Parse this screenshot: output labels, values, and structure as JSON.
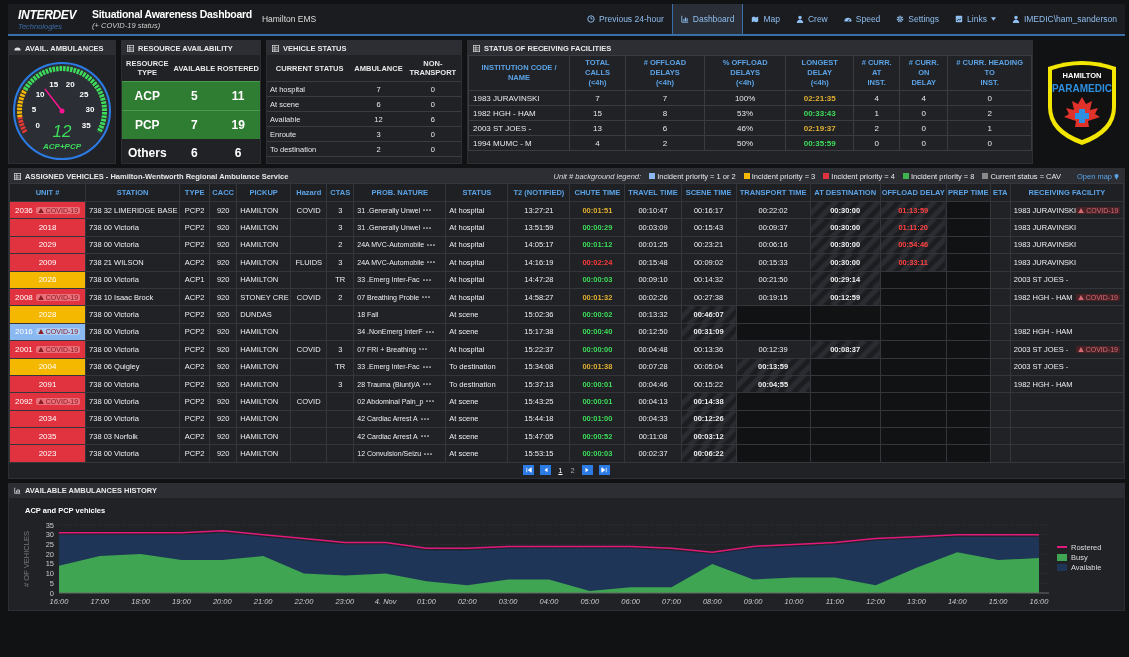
{
  "header": {
    "brand": "INTERDEV",
    "brand_sub": "Technologies",
    "title": "Situational Awareness Dashboard",
    "subtitle": "(+ COVID-19 status)",
    "org": "Hamilton EMS",
    "nav": [
      {
        "label": "Previous 24-hour",
        "kind": "clock",
        "selected": false
      },
      {
        "label": "Dashboard",
        "kind": "chart",
        "selected": true
      },
      {
        "label": "Map",
        "kind": "map",
        "selected": false
      },
      {
        "label": "Crew",
        "kind": "user",
        "selected": false
      },
      {
        "label": "Speed",
        "kind": "gauge",
        "selected": false
      },
      {
        "label": "Settings",
        "kind": "gear",
        "selected": false
      },
      {
        "label": "Links",
        "kind": "link",
        "selected": false,
        "dropdown": true
      },
      {
        "label": "IMEDIC\\ham_sanderson",
        "kind": "user",
        "selected": false
      }
    ]
  },
  "avail_ambulances": {
    "title": "AVAIL. AMBULANCES",
    "value": "12",
    "label": "ACP+PCP",
    "level": 0.343,
    "ticks": [
      "0",
      "5",
      "10",
      "15",
      "20",
      "25",
      "30",
      "35"
    ]
  },
  "resource_availability": {
    "title": "RESOURCE AVAILABILITY",
    "columns": [
      "RESOURCE TYPE",
      "AVAILABLE",
      "ROSTERED"
    ],
    "rows": [
      {
        "type": "ACP",
        "available": "5",
        "rostered": "11",
        "highlighted": true
      },
      {
        "type": "PCP",
        "available": "7",
        "rostered": "19",
        "highlighted": true
      },
      {
        "type": "Others",
        "available": "6",
        "rostered": "6",
        "highlighted": false
      }
    ]
  },
  "vehicle_status": {
    "title": "VEHICLE STATUS",
    "columns": [
      "CURRENT STATUS",
      "AMBULANCE",
      "NON-TRANSPORT"
    ],
    "rows": [
      [
        "At hospital",
        "7",
        "0"
      ],
      [
        "At scene",
        "6",
        "0"
      ],
      [
        "Available",
        "12",
        "6"
      ],
      [
        "Enroute",
        "3",
        "0"
      ],
      [
        "To destination",
        "2",
        "0"
      ]
    ]
  },
  "receiving_facilities": {
    "title": "STATUS OF RECEIVING FACILITIES",
    "columns": [
      {
        "label": "INSTITUTION CODE / NAME"
      },
      {
        "label": "TOTAL CALLS",
        "sub": "(<4h)"
      },
      {
        "label": "# OFFLOAD DELAYS",
        "sub": "(<4h)"
      },
      {
        "label": "% OFFLOAD DELAYS",
        "sub": "(<4h)"
      },
      {
        "label": "LONGEST DELAY",
        "sub": "(<4h)"
      },
      {
        "label": "# CURR. AT",
        "sub": "INST."
      },
      {
        "label": "# CURR. ON",
        "sub": "DELAY"
      },
      {
        "label": "# CURR. HEADING TO",
        "sub": "INST."
      }
    ],
    "rows": [
      {
        "name": "1983 JURAVINSKI",
        "total": "7",
        "delays": "7",
        "pct": "100%",
        "longest": {
          "text": "02:21:35",
          "color": "#e0b030"
        },
        "at": "4",
        "on_delay": "4",
        "heading": "0"
      },
      {
        "name": "1982 HGH - HAM",
        "total": "15",
        "delays": "8",
        "pct": "53%",
        "longest": {
          "text": "00:33:43",
          "color": "#3ddc5a"
        },
        "at": "1",
        "on_delay": "0",
        "heading": "2"
      },
      {
        "name": "2003 ST JOES -",
        "total": "13",
        "delays": "6",
        "pct": "46%",
        "longest": {
          "text": "02:19:37",
          "color": "#e0b030"
        },
        "at": "2",
        "on_delay": "0",
        "heading": "1"
      },
      {
        "name": "1994 MUMC - M",
        "total": "4",
        "delays": "2",
        "pct": "50%",
        "longest": {
          "text": "00:35:59",
          "color": "#3ddc5a"
        },
        "at": "0",
        "on_delay": "0",
        "heading": "0"
      }
    ]
  },
  "badge_logo": {
    "top": "HAMILTON",
    "main": "PARAMEDIC"
  },
  "assigned_vehicles": {
    "title": "ASSIGNED VEHICLES - Hamilton-Wentworth Regional Ambulance Service",
    "legend_label": "Unit # background legend:",
    "legend": [
      {
        "label": "Incident priority = 1 or 2",
        "color": "#8ab8f0"
      },
      {
        "label": "Incident priority = 3",
        "color": "#f5b800"
      },
      {
        "label": "Incident priority = 4",
        "color": "#e0323f"
      },
      {
        "label": "Incident priority = 8",
        "color": "#3fb34f"
      },
      {
        "label": "Current status = CAV",
        "color": "#8a8a8a"
      }
    ],
    "open_map": "Open map",
    "columns": [
      "UNIT #",
      "STATION",
      "TYPE",
      "CACC",
      "PICKUP",
      "Hazard",
      "CTAS",
      "PROB. NATURE",
      "STATUS",
      "T2 (NOTIFIED)",
      "CHUTE TIME",
      "TRAVEL TIME",
      "SCENE TIME",
      "TRANSPORT TIME",
      "AT DESTINATION",
      "OFFLOAD DELAY",
      "PREP TIME",
      "ETA",
      "RECEIVING FACILITY"
    ],
    "rows": [
      {
        "unit": "2036",
        "color": "#e0323f",
        "badge": "COVID-19",
        "station": "738 32 LIMERIDGE BASE",
        "type": "PCP2",
        "cacc": "920",
        "pickup": "HAMILTON",
        "hazard": "COVID",
        "ctas": "3",
        "nature": "31 .Generally Unwel",
        "more": true,
        "status": "At hospital",
        "t2": "13:27:21",
        "chute": {
          "text": "00:01:51",
          "color": "#e0b030"
        },
        "travel": "00:10:47",
        "scene": {
          "text": "00:16:17",
          "running": false
        },
        "transport": {
          "text": "00:22:02",
          "running": false
        },
        "at_destination": {
          "text": "00:30:00",
          "running": true
        },
        "offload": {
          "text": "01:13:59",
          "running": true
        },
        "facility": "1983 JURAVINSKI",
        "facility_badge": "COVID-19"
      },
      {
        "unit": "2018",
        "color": "#e0323f",
        "station": "738 00 Victoria",
        "type": "PCP2",
        "cacc": "920",
        "pickup": "HAMILTON",
        "ctas": "3",
        "nature": "31 .Generally Unwel",
        "more": true,
        "status": "At hospital",
        "t2": "13:51:59",
        "chute": {
          "text": "00:00:29",
          "color": "#3ddc5a"
        },
        "travel": "00:03:09",
        "scene": {
          "text": "00:15:43",
          "running": false
        },
        "transport": {
          "text": "00:09:37",
          "running": false
        },
        "at_destination": {
          "text": "00:30:00",
          "running": true
        },
        "offload": {
          "text": "01:11:20",
          "running": true
        },
        "facility": "1983 JURAVINSKI"
      },
      {
        "unit": "2029",
        "color": "#e0323f",
        "station": "738 00 Victoria",
        "type": "PCP2",
        "cacc": "920",
        "pickup": "HAMILTON",
        "ctas": "2",
        "nature": "24A MVC-Automobile",
        "more": true,
        "status": "At hospital",
        "t2": "14:05:17",
        "chute": {
          "text": "00:01:12",
          "color": "#3ddc5a"
        },
        "travel": "00:01:25",
        "scene": {
          "text": "00:23:21",
          "running": false
        },
        "transport": {
          "text": "00:06:16",
          "running": false
        },
        "at_destination": {
          "text": "00:30:00",
          "running": true
        },
        "offload": {
          "text": "00:54:46",
          "running": true
        },
        "facility": "1983 JURAVINSKI"
      },
      {
        "unit": "2009",
        "color": "#e0323f",
        "station": "738 21 WILSON",
        "type": "ACP2",
        "cacc": "920",
        "pickup": "HAMILTON",
        "hazard": "FLUIDS",
        "ctas": "3",
        "nature": "24A MVC-Automobile",
        "more": true,
        "status": "At hospital",
        "t2": "14:16:19",
        "chute": {
          "text": "00:02:24",
          "color": "#ff3b3b"
        },
        "travel": "00:15:48",
        "scene": {
          "text": "00:09:02",
          "running": false
        },
        "transport": {
          "text": "00:15:33",
          "running": false
        },
        "at_destination": {
          "text": "00:30:00",
          "running": true
        },
        "offload": {
          "text": "00:33:11",
          "running": true
        },
        "facility": "1983 JURAVINSKI"
      },
      {
        "unit": "2026",
        "color": "#f5b800",
        "station": "738 00 Victoria",
        "type": "ACP1",
        "cacc": "920",
        "pickup": "HAMILTON",
        "ctas": "TR",
        "nature": "33 .Emerg Inter-Fac",
        "more": true,
        "status": "At hospital",
        "t2": "14:47:28",
        "chute": {
          "text": "00:00:03",
          "color": "#3ddc5a"
        },
        "travel": "00:09:10",
        "scene": {
          "text": "00:14:32",
          "running": false
        },
        "transport": {
          "text": "00:21:50",
          "running": false
        },
        "at_destination": {
          "text": "00:29:14",
          "running": true
        },
        "facility": "2003 ST JOES -"
      },
      {
        "unit": "2008",
        "color": "#e0323f",
        "badge": "COVID-19",
        "station": "738 10 Isaac Brock",
        "type": "ACP2",
        "cacc": "920",
        "pickup": "STONEY CRE",
        "hazard": "COVID",
        "ctas": "2",
        "nature": "07 Breathing Proble",
        "more": true,
        "status": "At hospital",
        "t2": "14:58:27",
        "chute": {
          "text": "00:01:32",
          "color": "#e0b030"
        },
        "travel": "00:02:26",
        "scene": {
          "text": "00:27:38",
          "running": false
        },
        "transport": {
          "text": "00:19:15",
          "running": false
        },
        "at_destination": {
          "text": "00:12:59",
          "running": true
        },
        "facility": "1982 HGH - HAM",
        "facility_badge": "COVID-19"
      },
      {
        "unit": "2028",
        "color": "#f5b800",
        "station": "738 00 Victoria",
        "type": "PCP2",
        "cacc": "920",
        "pickup": "DUNDAS",
        "nature": "18 Fall",
        "more": false,
        "status": "At scene",
        "t2": "15:02:36",
        "chute": {
          "text": "00:00:02",
          "color": "#3ddc5a"
        },
        "travel": "00:13:32",
        "scene": {
          "text": "00:46:07",
          "running": true
        }
      },
      {
        "unit": "2016",
        "color": "#8ab8f0",
        "badge": "COVID-19",
        "station": "738 00 Victoria",
        "type": "PCP2",
        "cacc": "920",
        "pickup": "HAMILTON",
        "nature": "34 .NonEmerg InterF",
        "more": true,
        "status": "At scene",
        "t2": "15:17:38",
        "chute": {
          "text": "00:00:40",
          "color": "#3ddc5a"
        },
        "travel": "00:12:50",
        "scene": {
          "text": "00:31:09",
          "running": true
        },
        "facility": "1982 HGH - HAM"
      },
      {
        "unit": "2001",
        "color": "#e0323f",
        "badge": "COVID-19",
        "station": "738 00 Victoria",
        "type": "PCP2",
        "cacc": "920",
        "pickup": "HAMILTON",
        "hazard": "COVID",
        "ctas": "3",
        "nature": "07 FRI + Breathing",
        "more": true,
        "status": "At hospital",
        "t2": "15:22:37",
        "chute": {
          "text": "00:00:00",
          "color": "#3ddc5a"
        },
        "travel": "00:04:48",
        "scene": {
          "text": "00:13:36",
          "running": false
        },
        "transport": {
          "text": "00:12:39",
          "running": false
        },
        "at_destination": {
          "text": "00:08:37",
          "running": true
        },
        "facility": "2003 ST JOES -",
        "facility_badge": "COVID-19"
      },
      {
        "unit": "2004",
        "color": "#f5b800",
        "station": "738 06 Quigley",
        "type": "ACP2",
        "cacc": "920",
        "pickup": "HAMILTON",
        "ctas": "TR",
        "nature": "33 .Emerg Inter-Fac",
        "more": true,
        "status": "To destination",
        "t2": "15:34:08",
        "chute": {
          "text": "00:01:38",
          "color": "#e0b030"
        },
        "travel": "00:07:28",
        "scene": {
          "text": "00:05:04",
          "running": false
        },
        "transport": {
          "text": "00:13:59",
          "running": true
        },
        "facility": "2003 ST JOES -"
      },
      {
        "unit": "2091",
        "color": "#e0323f",
        "station": "738 00 Victoria",
        "type": "PCP2",
        "cacc": "920",
        "pickup": "HAMILTON",
        "ctas": "3",
        "nature": "28 Trauma (Blunt)/A",
        "more": true,
        "status": "To destination",
        "t2": "15:37:13",
        "chute": {
          "text": "00:00:01",
          "color": "#3ddc5a"
        },
        "travel": "00:04:46",
        "scene": {
          "text": "00:15:22",
          "running": false
        },
        "transport": {
          "text": "00:04:55",
          "running": true
        },
        "facility": "1982 HGH - HAM"
      },
      {
        "unit": "2092",
        "color": "#e0323f",
        "badge": "COVID-19",
        "station": "738 00 Victoria",
        "type": "PCP2",
        "cacc": "920",
        "pickup": "HAMILTON",
        "hazard": "COVID",
        "nature": "02 Abdominal Pain_p",
        "more": true,
        "status": "At scene",
        "t2": "15:43:25",
        "chute": {
          "text": "00:00:01",
          "color": "#3ddc5a"
        },
        "travel": "00:04:13",
        "scene": {
          "text": "00:14:38",
          "running": true
        }
      },
      {
        "unit": "2034",
        "color": "#e0323f",
        "station": "738 00 Victoria",
        "type": "PCP2",
        "cacc": "920",
        "pickup": "HAMILTON",
        "nature": "42 Cardiac Arrest A",
        "more": true,
        "status": "At scene",
        "t2": "15:44:18",
        "chute": {
          "text": "00:01:00",
          "color": "#3ddc5a"
        },
        "travel": "00:04:33",
        "scene": {
          "text": "00:12:26",
          "running": true
        }
      },
      {
        "unit": "2035",
        "color": "#e0323f",
        "station": "738 03 Norfolk",
        "type": "ACP2",
        "cacc": "920",
        "pickup": "HAMILTON",
        "nature": "42 Cardiac Arrest A",
        "more": true,
        "status": "At scene",
        "t2": "15:47:05",
        "chute": {
          "text": "00:00:52",
          "color": "#3ddc5a"
        },
        "travel": "00:11:08",
        "scene": {
          "text": "00:03:12",
          "running": true
        }
      },
      {
        "unit": "2023",
        "color": "#e0323f",
        "station": "738 00 Victoria",
        "type": "PCP2",
        "cacc": "920",
        "pickup": "HAMILTON",
        "nature": "12 Convulsion/Seizu",
        "more": true,
        "status": "At scene",
        "t2": "15:53:15",
        "chute": {
          "text": "00:00:03",
          "color": "#3ddc5a"
        },
        "travel": "00:02:37",
        "scene": {
          "text": "00:06:22",
          "running": true
        }
      }
    ],
    "pages": [
      {
        "label": "1",
        "selected": true
      },
      {
        "label": "2",
        "selected": false
      }
    ]
  },
  "history": {
    "title": "AVAILABLE AMBULANCES HISTORY",
    "chart_data": {
      "type": "area",
      "title": "ACP and PCP vehicles",
      "ylabel": "# OF VEHICLES",
      "grid": true,
      "legend": true,
      "categories": [
        "16:00",
        "17:00",
        "18:00",
        "19:00",
        "20:00",
        "21:00",
        "22:00",
        "23:00",
        "4. Nov",
        "01:00",
        "02:00",
        "03:00",
        "04:00",
        "05:00",
        "06:00",
        "07:00",
        "08:00",
        "09:00",
        "10:00",
        "11:00",
        "12:00",
        "13:00",
        "14:00",
        "15:00",
        "16:00"
      ],
      "series": [
        {
          "name": "Rostered",
          "type": "line",
          "color": "#e0197d",
          "values": [
            31,
            31,
            31,
            31,
            32,
            30,
            28,
            26,
            26,
            23,
            23,
            24,
            24,
            24,
            24,
            23,
            21,
            24,
            25,
            26,
            28,
            29,
            30,
            30,
            30
          ]
        },
        {
          "name": "Busy",
          "color": "#3fa552",
          "values": [
            14,
            19,
            20,
            17,
            17,
            19,
            10,
            9,
            10,
            6,
            4,
            7,
            7,
            1,
            3,
            3,
            15,
            7,
            8,
            8,
            4,
            13,
            21,
            17,
            18
          ]
        },
        {
          "name": "Available",
          "color": "#1e3557",
          "values": [
            30,
            30,
            30,
            30,
            31,
            29,
            27,
            25,
            25,
            22,
            22,
            23,
            23,
            23,
            23,
            22,
            20,
            23,
            24,
            25,
            27,
            28,
            29,
            29,
            29
          ]
        }
      ],
      "ylim": [
        0,
        35
      ],
      "yticks": [
        0,
        5,
        10,
        15,
        20,
        25,
        30,
        35
      ]
    }
  }
}
